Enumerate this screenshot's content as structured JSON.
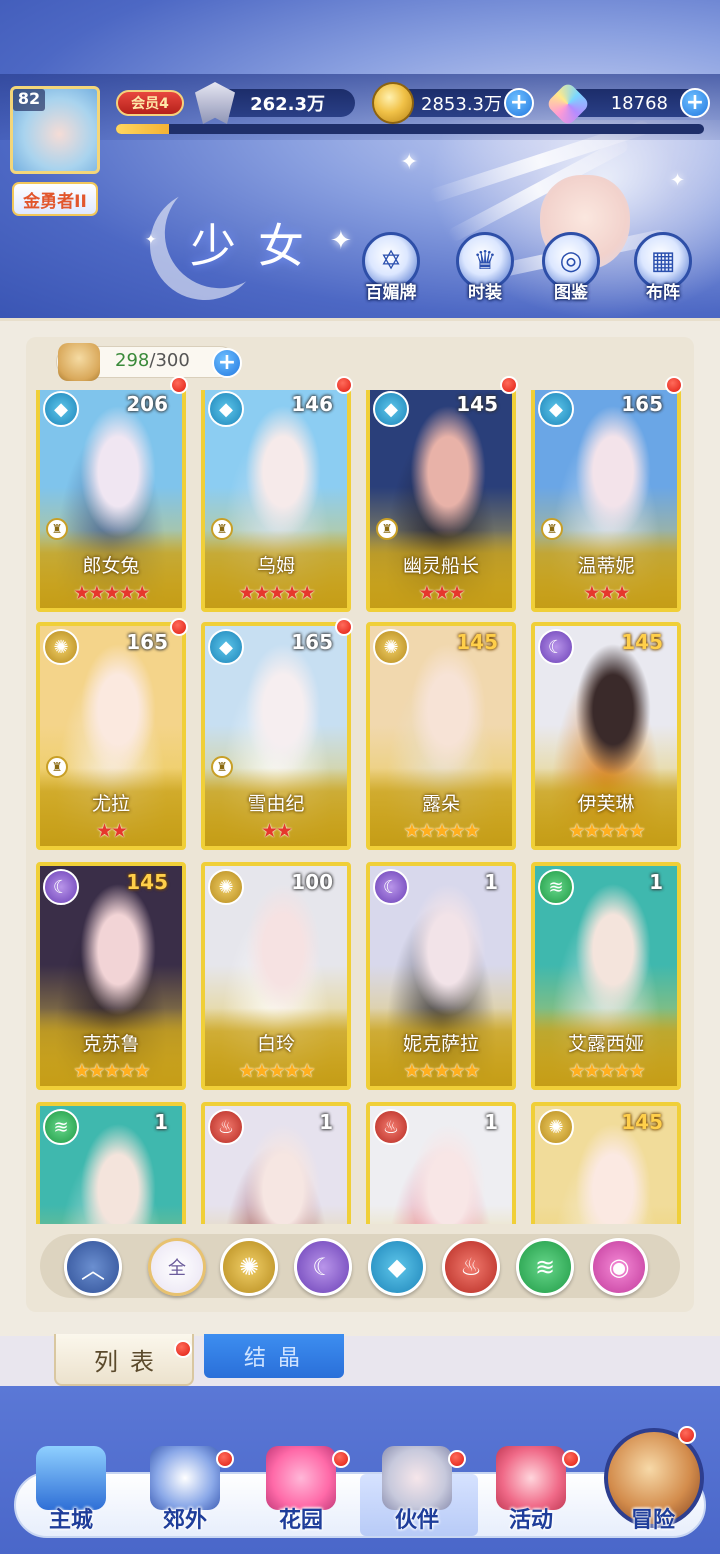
{
  "player": {
    "level": "82",
    "title": "金勇者II",
    "vip": "会员4",
    "power": "262.3万",
    "exp_fraction": 0.09,
    "gold": "2853.3万",
    "gems": "18768"
  },
  "header": {
    "page_title": "少女",
    "functions": [
      {
        "label": "百媚牌",
        "icon": "card-icon"
      },
      {
        "label": "时装",
        "icon": "outfit-icon"
      },
      {
        "label": "图鉴",
        "icon": "book-icon"
      },
      {
        "label": "布阵",
        "icon": "formation-icon"
      }
    ]
  },
  "roster": {
    "count_current": "298",
    "count_sep": "/",
    "count_max": "300",
    "cards": [
      {
        "name": "郎女兔",
        "level": "206",
        "element": "water",
        "stars": 5,
        "star_color": "red",
        "role": true,
        "dot": true,
        "level_color": "white",
        "art": [
          "#7fc4ec",
          "#f0e6f2",
          "#3f5a8e"
        ]
      },
      {
        "name": "乌姆",
        "level": "146",
        "element": "water",
        "stars": 5,
        "star_color": "red",
        "role": true,
        "dot": true,
        "level_color": "white",
        "art": [
          "#8ccdf2",
          "#f6eaea",
          "#d8e5f2"
        ]
      },
      {
        "name": "幽灵船长",
        "level": "145",
        "element": "water",
        "stars": 3,
        "star_color": "red",
        "role": true,
        "dot": true,
        "level_color": "white",
        "art": [
          "#2a3f7a",
          "#e8b2a8",
          "#1b1b2e"
        ]
      },
      {
        "name": "温蒂妮",
        "level": "165",
        "element": "water",
        "stars": 3,
        "star_color": "red",
        "role": true,
        "dot": true,
        "level_color": "white",
        "art": [
          "#6aa6e6",
          "#f3e3ea",
          "#dfe9f6"
        ]
      },
      {
        "name": "尤拉",
        "level": "165",
        "element": "light",
        "stars": 2,
        "star_color": "red",
        "role": true,
        "dot": true,
        "level_color": "white",
        "art": [
          "#f4d48a",
          "#fbe9df",
          "#f8f0ea"
        ]
      },
      {
        "name": "雪由纪",
        "level": "165",
        "element": "water",
        "stars": 2,
        "star_color": "red",
        "role": true,
        "dot": true,
        "level_color": "white",
        "art": [
          "#c7dff2",
          "#f6eef0",
          "#ffffff"
        ]
      },
      {
        "name": "露朵",
        "level": "145",
        "element": "light",
        "stars": 5,
        "star_color": "gold",
        "role": false,
        "dot": false,
        "level_color": "gold",
        "art": [
          "#f1d8ae",
          "#f7e3d6",
          "#e8e2d4"
        ]
      },
      {
        "name": "伊芙琳",
        "level": "145",
        "element": "dark",
        "stars": 5,
        "star_color": "gold",
        "role": false,
        "dot": false,
        "level_color": "gold",
        "art": [
          "#e9e9f0",
          "#3a2a2a",
          "#d9781c"
        ]
      },
      {
        "name": "克苏鲁",
        "level": "145",
        "element": "dark",
        "stars": 5,
        "star_color": "gold",
        "role": false,
        "dot": false,
        "level_color": "gold",
        "art": [
          "#3a2e48",
          "#f2d4d6",
          "#231a2e"
        ]
      },
      {
        "name": "白玲",
        "level": "100",
        "element": "light",
        "stars": 5,
        "star_color": "gold",
        "role": false,
        "dot": false,
        "level_color": "white",
        "art": [
          "#e6e6ec",
          "#f6e2e2",
          "#ffffff"
        ]
      },
      {
        "name": "妮克萨拉",
        "level": "1",
        "element": "dark",
        "stars": 5,
        "star_color": "gold",
        "role": false,
        "dot": false,
        "level_color": "white",
        "art": [
          "#d8d8ec",
          "#f2e3e8",
          "#2a2a34"
        ]
      },
      {
        "name": "艾露西娅",
        "level": "1",
        "element": "wind",
        "stars": 5,
        "star_color": "gold",
        "role": false,
        "dot": false,
        "level_color": "white",
        "art": [
          "#3fb8ae",
          "#f4e4dc",
          "#e9eef0"
        ]
      },
      {
        "name": "",
        "level": "1",
        "element": "wind",
        "stars": 0,
        "star_color": "gold",
        "role": false,
        "dot": false,
        "level_color": "white",
        "art": [
          "#3fb8ae",
          "#f4e4dc",
          "#e9eef0"
        ]
      },
      {
        "name": "",
        "level": "1",
        "element": "fire",
        "stars": 0,
        "star_color": "gold",
        "role": false,
        "dot": false,
        "level_color": "white",
        "art": [
          "#e6e2ee",
          "#f6e6e2",
          "#8a2430"
        ]
      },
      {
        "name": "",
        "level": "1",
        "element": "fire",
        "stars": 0,
        "star_color": "gold",
        "role": false,
        "dot": false,
        "level_color": "white",
        "art": [
          "#eeeef2",
          "#f8e6e6",
          "#e85a78"
        ]
      },
      {
        "name": "",
        "level": "145",
        "element": "light",
        "stars": 0,
        "star_color": "gold",
        "role": false,
        "dot": false,
        "level_color": "gold",
        "art": [
          "#f1dc9a",
          "#fbe9e2",
          "#f6f2ee"
        ]
      }
    ]
  },
  "filters": [
    {
      "id": "up",
      "icon": "up-arrow-icon",
      "label": ""
    },
    {
      "id": "all",
      "icon": "all-icon",
      "label": "全"
    },
    {
      "id": "light",
      "icon": "sun-icon",
      "label": ""
    },
    {
      "id": "dark",
      "icon": "moon-icon",
      "label": ""
    },
    {
      "id": "water",
      "icon": "water-drop-icon",
      "label": ""
    },
    {
      "id": "fire",
      "icon": "flame-icon",
      "label": ""
    },
    {
      "id": "wind",
      "icon": "tornado-icon",
      "label": ""
    },
    {
      "id": "pink",
      "icon": "orb-icon",
      "label": ""
    }
  ],
  "tabs": {
    "list": "列表",
    "crystal": "结晶"
  },
  "bottom_nav": [
    {
      "label": "主城",
      "icon": "castle-icon",
      "dot": false
    },
    {
      "label": "郊外",
      "icon": "compass-icon",
      "dot": true
    },
    {
      "label": "花园",
      "icon": "heart-icon",
      "dot": true
    },
    {
      "label": "伙伴",
      "icon": "partner-icon",
      "dot": true
    },
    {
      "label": "活动",
      "icon": "gift-icon",
      "dot": true
    },
    {
      "label": "冒险",
      "icon": "sword-icon",
      "dot": true
    }
  ],
  "colors": {
    "card_border": "#f0cf38",
    "accent_blue": "#2378e0",
    "red_dot": "#e01d12"
  }
}
